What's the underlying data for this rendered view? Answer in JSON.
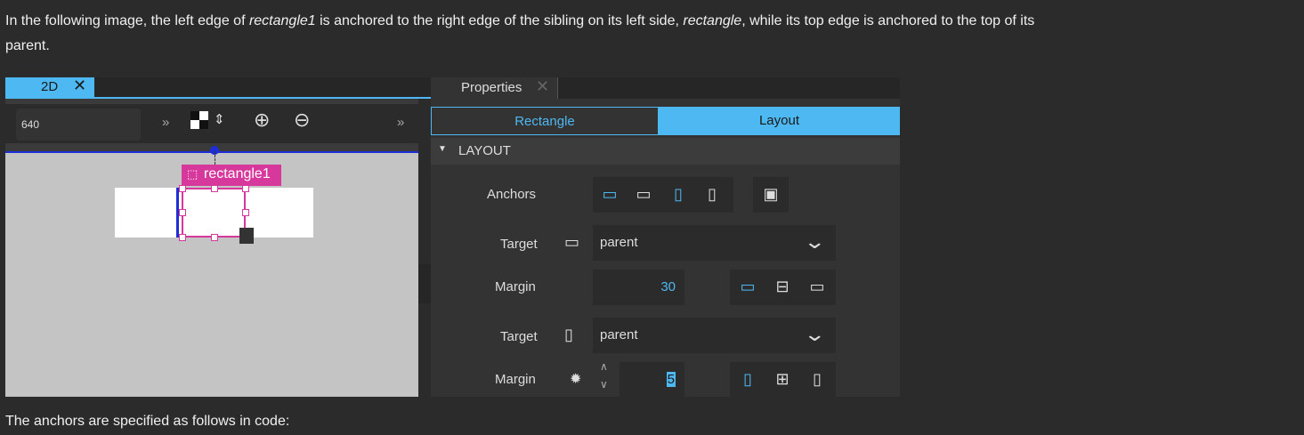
{
  "paragraph": {
    "part1": "In the following image, the left edge of ",
    "em1": "rectangle1",
    "part2": " is anchored to the right edge of the sibling on its left side, ",
    "em2": "rectangle",
    "part3": ", while its top edge is anchored to the top of its",
    "line2": "parent."
  },
  "editor": {
    "tab_label": "2D",
    "tab_close": "✕",
    "zoom_value": "640",
    "more_left": "»",
    "more_right": "»",
    "zoom_in": "⊕",
    "zoom_out": "⊖",
    "selected_item": "rectangle1"
  },
  "properties": {
    "tab_label": "Properties",
    "tab_close": "✕",
    "segments": [
      "Rectangle",
      "Layout"
    ],
    "section_title": "LAYOUT",
    "anchors_label": "Anchors",
    "target1_label": "Target",
    "target1_value": "parent",
    "margin1_label": "Margin",
    "margin1_value": "30",
    "target2_label": "Target",
    "target2_value": "parent",
    "margin2_label": "Margin",
    "margin2_value": "5"
  },
  "footer": {
    "text": "The anchors are specified as follows in code:"
  },
  "colors": {
    "accent": "#4eb8f2",
    "selection": "#d6389b",
    "anchor_line": "#1e2ed6"
  }
}
